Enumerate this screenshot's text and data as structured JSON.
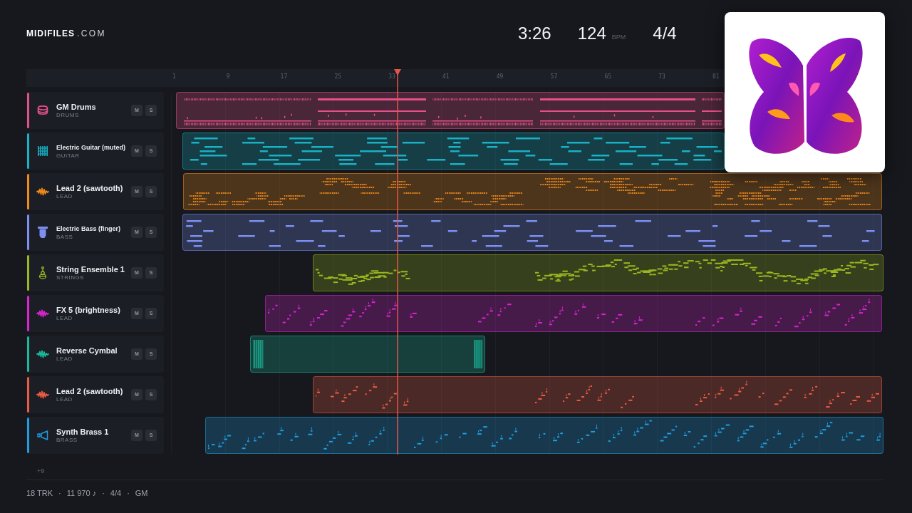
{
  "header": {
    "logo": {
      "name": "MIDIFILES",
      "domain": ".COM"
    },
    "duration": "3:26",
    "tempo": {
      "value": "124",
      "unit": "BPM"
    },
    "time_signature": "4/4"
  },
  "ruler": {
    "marks": [
      "1",
      "9",
      "17",
      "25",
      "33",
      "41",
      "49",
      "57",
      "65",
      "73",
      "81"
    ]
  },
  "playhead": {
    "level": 0.306
  },
  "tracks": [
    {
      "name": "GM Drums",
      "category": "DRUMS",
      "kind": "drums",
      "color": "#e5508b",
      "buttons": [
        "M",
        "S"
      ]
    },
    {
      "name": "Electric Guitar (muted)",
      "category": "GUITAR",
      "kind": "guitar",
      "color": "#18b1c5",
      "buttons": [
        "M",
        "S"
      ]
    },
    {
      "name": "Lead 2 (sawtooth)",
      "category": "LEAD",
      "kind": "lead",
      "color": "#f28a1a",
      "buttons": [
        "M",
        "S"
      ]
    },
    {
      "name": "Electric Bass (finger)",
      "category": "BASS",
      "kind": "bass",
      "color": "#7d8ff2",
      "buttons": [
        "M",
        "S"
      ]
    },
    {
      "name": "String Ensemble 1",
      "category": "STRINGS",
      "kind": "strings",
      "color": "#9ab81f",
      "buttons": [
        "M",
        "S"
      ]
    },
    {
      "name": "FX 5 (brightness)",
      "category": "LEAD",
      "kind": "lead",
      "color": "#d924d0",
      "buttons": [
        "M",
        "S"
      ]
    },
    {
      "name": "Reverse Cymbal",
      "category": "LEAD",
      "kind": "lead",
      "color": "#1cb89c",
      "buttons": [
        "M",
        "S"
      ]
    },
    {
      "name": "Lead 2 (sawtooth)",
      "category": "LEAD",
      "kind": "lead",
      "color": "#ec5b43",
      "buttons": [
        "M",
        "S"
      ]
    },
    {
      "name": "Synth Brass 1",
      "category": "BRASS",
      "kind": "brass",
      "color": "#1e9de0",
      "buttons": [
        "M",
        "S"
      ]
    }
  ],
  "more_tracks": "+9",
  "status_bar": [
    "18 TRK",
    "·",
    "11 970 ♪",
    "·",
    "4/4",
    "·",
    "GM"
  ]
}
